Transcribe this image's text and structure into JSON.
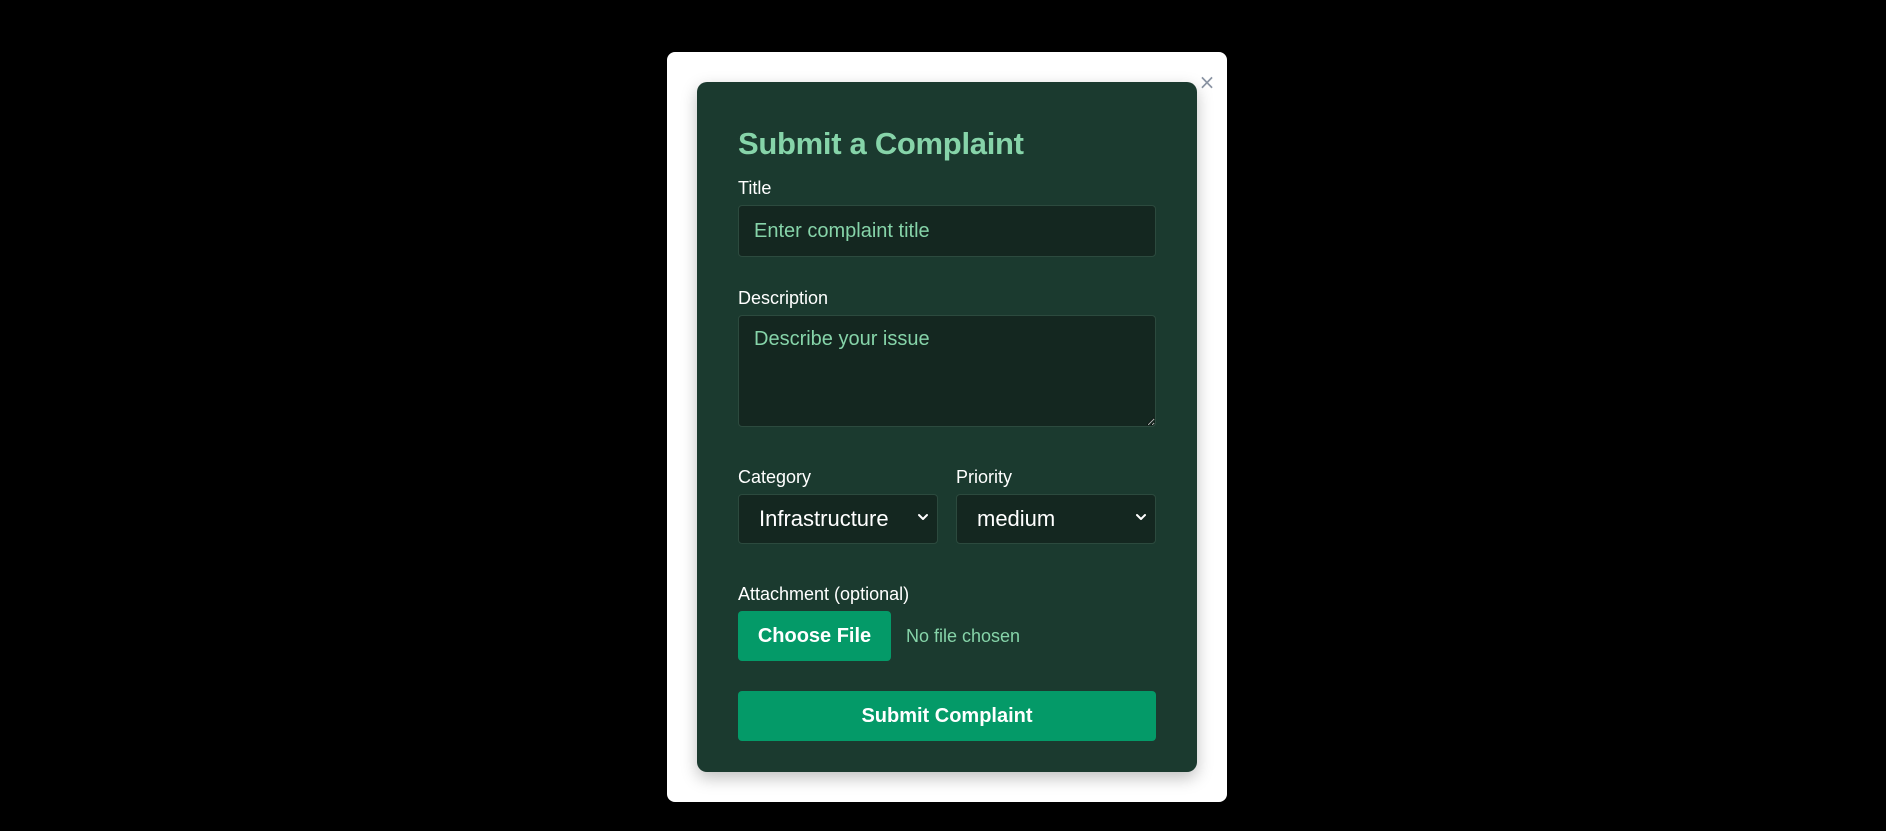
{
  "modal": {
    "close_label": "×"
  },
  "form": {
    "heading": "Submit a Complaint",
    "title_label": "Title",
    "title_placeholder": "Enter complaint title",
    "description_label": "Description",
    "description_placeholder": "Describe your issue",
    "category_label": "Category",
    "category_value": "Infrastructure",
    "priority_label": "Priority",
    "priority_value": "medium",
    "attachment_label": "Attachment (optional)",
    "choose_file_label": "Choose File",
    "no_file_text": "No file chosen",
    "submit_label": "Submit Complaint"
  },
  "colors": {
    "backdrop": "#000000",
    "modal_bg": "#ffffff",
    "card_bg": "#1b3a2f",
    "input_bg": "#142720",
    "accent_text": "#86d4a9",
    "button_bg": "#049a68"
  },
  "icons": {
    "close": "close-icon",
    "select_chevron": "chevron-down-icon"
  }
}
